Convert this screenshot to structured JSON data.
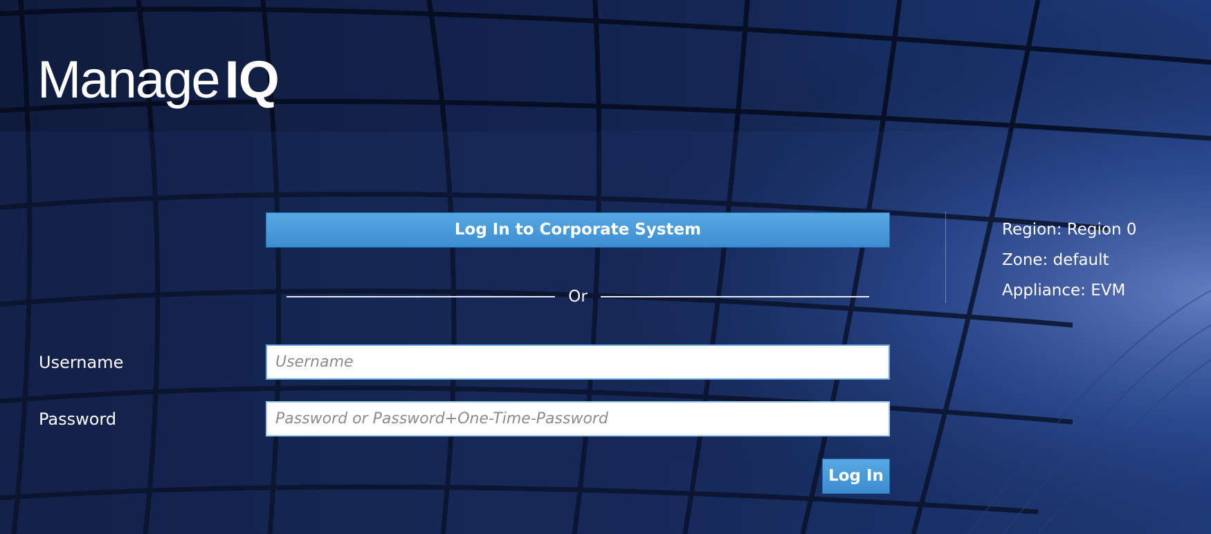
{
  "brand": {
    "logo_text_regular": "Manage",
    "logo_text_bold": "IQ"
  },
  "sso": {
    "button_label": "Log In to Corporate System"
  },
  "separator": {
    "label": "Or"
  },
  "form": {
    "username_label": "Username",
    "username_placeholder": "Username",
    "username_value": "",
    "password_label": "Password",
    "password_placeholder": "Password or Password+One-Time-Password",
    "password_value": "",
    "submit_label": "Log In"
  },
  "server_info": {
    "region": "Region: Region 0",
    "zone": "Zone: default",
    "appliance": "Appliance: EVM"
  },
  "colors": {
    "background": "#0c1834",
    "button": "#4a9bdb",
    "text": "#ffffff"
  }
}
